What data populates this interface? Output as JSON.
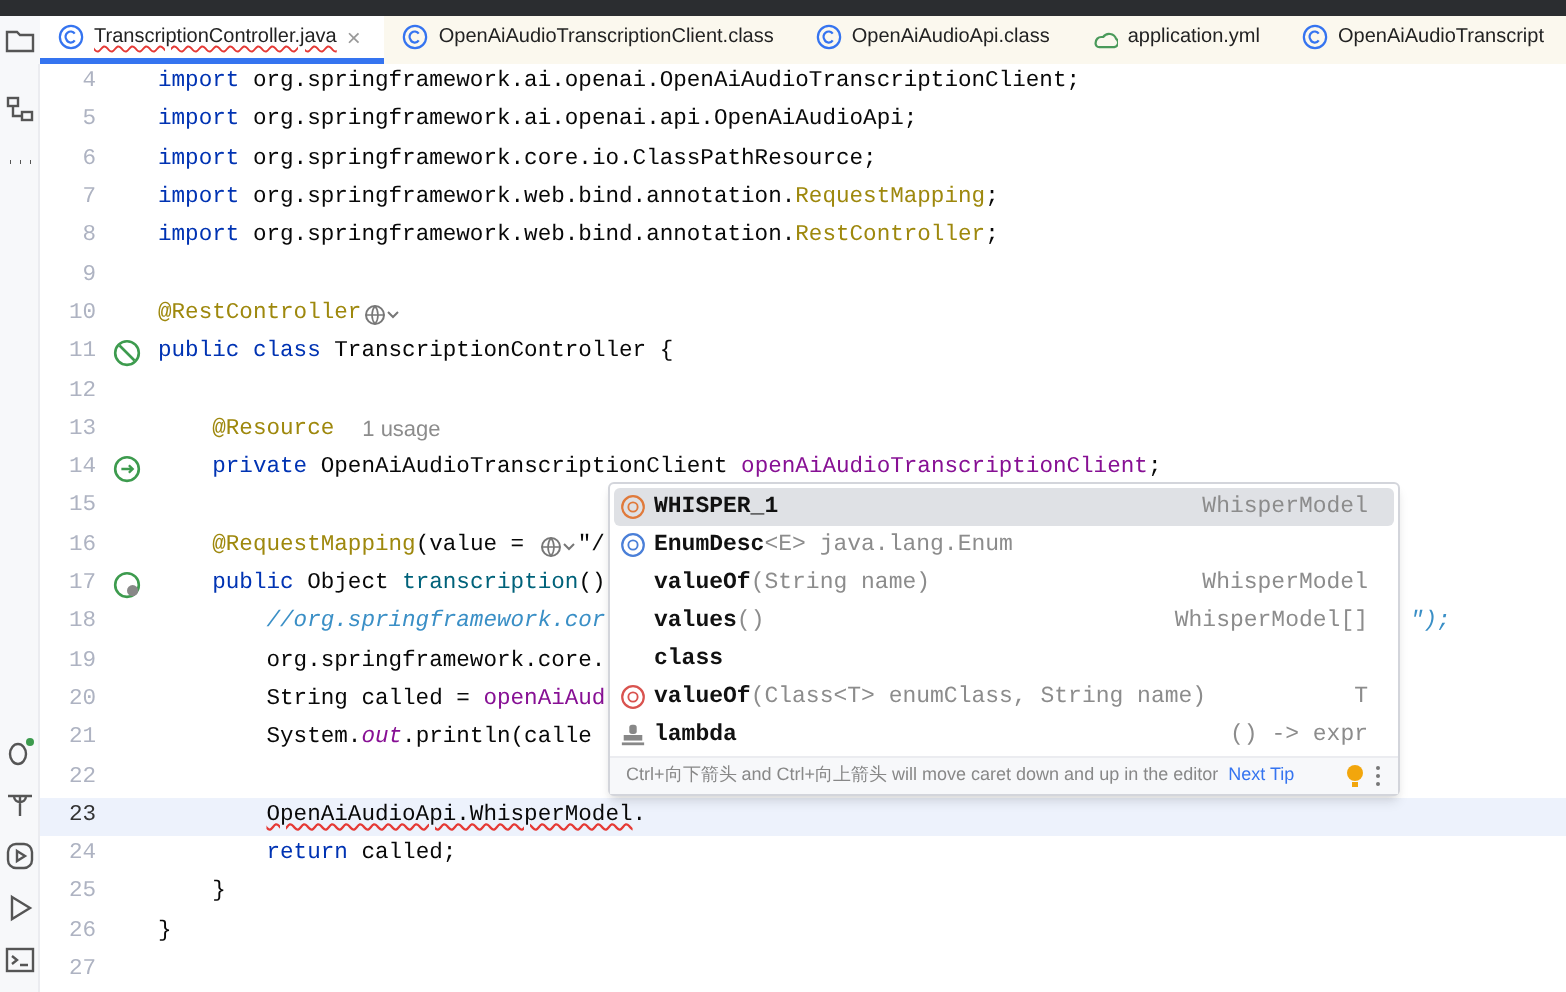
{
  "tabs": [
    {
      "label": "TranscriptionController.java",
      "kind": "class",
      "selected": true,
      "error": true,
      "close": "×"
    },
    {
      "label": "OpenAiAudioTranscriptionClient.class",
      "kind": "class",
      "selected": false,
      "error": false
    },
    {
      "label": "OpenAiAudioApi.class",
      "kind": "class",
      "selected": false,
      "error": false
    },
    {
      "label": "application.yml",
      "kind": "yaml",
      "selected": false,
      "error": false
    },
    {
      "label": "OpenAiAudioTranscript",
      "kind": "class",
      "selected": false,
      "error": false
    }
  ],
  "lines": [
    {
      "number": "4",
      "current": false,
      "tokens": [
        {
          "kind": "kw",
          "text": "import"
        },
        {
          "kind": "plain",
          "text": " org.springframework.ai.openai.OpenAiAudioTranscriptionClient;"
        }
      ]
    },
    {
      "number": "5",
      "current": false,
      "tokens": [
        {
          "kind": "kw",
          "text": "import"
        },
        {
          "kind": "plain",
          "text": " org.springframework.ai.openai.api.OpenAiAudioApi;"
        }
      ]
    },
    {
      "number": "6",
      "current": false,
      "tokens": [
        {
          "kind": "kw",
          "text": "import"
        },
        {
          "kind": "plain",
          "text": " org.springframework.core.io.ClassPathResource;"
        }
      ]
    },
    {
      "number": "7",
      "current": false,
      "tokens": [
        {
          "kind": "kw",
          "text": "import"
        },
        {
          "kind": "plain",
          "text": " org.springframework.web.bind.annotation."
        },
        {
          "kind": "anno",
          "text": "RequestMapping"
        },
        {
          "kind": "plain",
          "text": ";"
        }
      ]
    },
    {
      "number": "8",
      "current": false,
      "tokens": [
        {
          "kind": "kw",
          "text": "import"
        },
        {
          "kind": "plain",
          "text": " org.springframework.web.bind.annotation."
        },
        {
          "kind": "anno",
          "text": "RestController"
        },
        {
          "kind": "plain",
          "text": ";"
        }
      ]
    },
    {
      "number": "9",
      "current": false
    },
    {
      "number": "10",
      "current": false,
      "tokens": [
        {
          "kind": "anno",
          "text": "@RestController"
        },
        {
          "kind": "globe-menu"
        }
      ]
    },
    {
      "number": "11",
      "current": false,
      "kind": "bean",
      "tokens": [
        {
          "kind": "kw",
          "text": "public class"
        },
        {
          "kind": "plain",
          "text": " TranscriptionController {"
        }
      ]
    },
    {
      "number": "12",
      "current": false
    },
    {
      "number": "13",
      "current": false,
      "tokens": [
        {
          "kind": "anno",
          "text": "    @Resource"
        },
        {
          "kind": "hint",
          "text": "1 usage"
        }
      ]
    },
    {
      "number": "14",
      "current": false,
      "kind": "inject",
      "tokens": [
        {
          "kind": "kw",
          "text": "    private"
        },
        {
          "kind": "plain",
          "text": " OpenAiAudioTranscriptionClient "
        },
        {
          "kind": "field",
          "text": "openAiAudioTranscriptionClient"
        },
        {
          "kind": "plain",
          "text": ";"
        }
      ]
    },
    {
      "number": "15",
      "current": false
    },
    {
      "number": "16",
      "current": false,
      "tokens": [
        {
          "kind": "anno",
          "text": "    @RequestMapping"
        },
        {
          "kind": "plain",
          "text": "(value = "
        },
        {
          "kind": "globe-menu"
        },
        {
          "kind": "plain",
          "text": "\"/"
        }
      ]
    },
    {
      "number": "17",
      "current": false,
      "kind": "endpoint",
      "tokens": [
        {
          "kind": "kw",
          "text": "    public"
        },
        {
          "kind": "plain",
          "text": " Object "
        },
        {
          "kind": "method",
          "text": "transcription"
        },
        {
          "kind": "plain",
          "text": "()"
        }
      ]
    },
    {
      "number": "18",
      "current": false,
      "tokens": [
        {
          "kind": "comment",
          "text": "        //org.springframework.cor"
        },
        {
          "kind": "tail",
          "text": "\");"
        }
      ]
    },
    {
      "number": "19",
      "current": false,
      "tokens": [
        {
          "kind": "plain",
          "text": "        org.springframework.core."
        }
      ]
    },
    {
      "number": "20",
      "current": false,
      "tokens": [
        {
          "kind": "plain",
          "text": "        String called = "
        },
        {
          "kind": "field",
          "text": "openAiAud"
        }
      ]
    },
    {
      "number": "21",
      "current": false,
      "tokens": [
        {
          "kind": "plain",
          "text": "        System."
        },
        {
          "kind": "static",
          "text": "out"
        },
        {
          "kind": "plain",
          "text": ".println(calle"
        }
      ]
    },
    {
      "number": "22",
      "current": false
    },
    {
      "number": "23",
      "current": true,
      "tokens": [
        {
          "kind": "error",
          "text": "        OpenAiAudioApi.WhisperModel"
        },
        {
          "kind": "plain",
          "text": "."
        }
      ]
    },
    {
      "number": "24",
      "current": false,
      "tokens": [
        {
          "kind": "kw",
          "text": "        return"
        },
        {
          "kind": "plain",
          "text": " called;"
        }
      ]
    },
    {
      "number": "25",
      "current": false,
      "tokens": [
        {
          "kind": "plain",
          "text": "    }"
        }
      ]
    },
    {
      "number": "26",
      "current": false,
      "tokens": [
        {
          "kind": "plain",
          "text": "}"
        }
      ]
    },
    {
      "number": "27",
      "current": false
    }
  ],
  "completion": {
    "items": [
      {
        "kind": "constant",
        "name": "WHISPER_1",
        "type": "WhisperModel",
        "selected": true
      },
      {
        "kind": "enum",
        "name": "EnumDesc",
        "params": "<E> java.lang.Enum",
        "selected": false
      },
      {
        "name": "valueOf",
        "params": "(String name)",
        "type": "WhisperModel",
        "selected": false
      },
      {
        "name": "values",
        "params": "()",
        "type": "WhisperModel[]",
        "selected": false
      },
      {
        "name": "class",
        "selected": false
      },
      {
        "kind": "method",
        "name": "valueOf",
        "params": "(Class<T> enumClass, String name)",
        "type": "T",
        "selected": false
      },
      {
        "kind": "template",
        "name": "lambda",
        "type": "() -> expr",
        "selected": false
      }
    ],
    "hint": "Ctrl+向下箭头 and Ctrl+向上箭头 will move caret down and up in the editor",
    "next_tip": "Next Tip"
  }
}
